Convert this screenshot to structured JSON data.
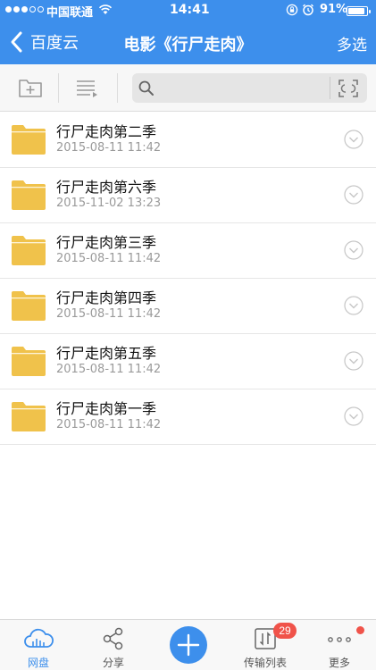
{
  "status": {
    "carrier": "中国联通",
    "time": "14:41",
    "battery": "91%",
    "battery_level": 0.91
  },
  "nav": {
    "back_label": "百度云",
    "title": "电影《行尸走肉》",
    "multi_select": "多选"
  },
  "search": {
    "placeholder": ""
  },
  "folders": [
    {
      "name": "行尸走肉第二季",
      "date": "2015-08-11 11:42"
    },
    {
      "name": "行尸走肉第六季",
      "date": "2015-11-02 13:23"
    },
    {
      "name": "行尸走肉第三季",
      "date": "2015-08-11 11:42"
    },
    {
      "name": "行尸走肉第四季",
      "date": "2015-08-11 11:42"
    },
    {
      "name": "行尸走肉第五季",
      "date": "2015-08-11 11:42"
    },
    {
      "name": "行尸走肉第一季",
      "date": "2015-08-11 11:42"
    }
  ],
  "tabs": {
    "disk": "网盘",
    "share": "分享",
    "transfer": "传输列表",
    "more": "更多",
    "transfer_badge": "29"
  },
  "colors": {
    "accent": "#3d8fec",
    "folder": "#f0c24b",
    "badge": "#f0534a"
  }
}
